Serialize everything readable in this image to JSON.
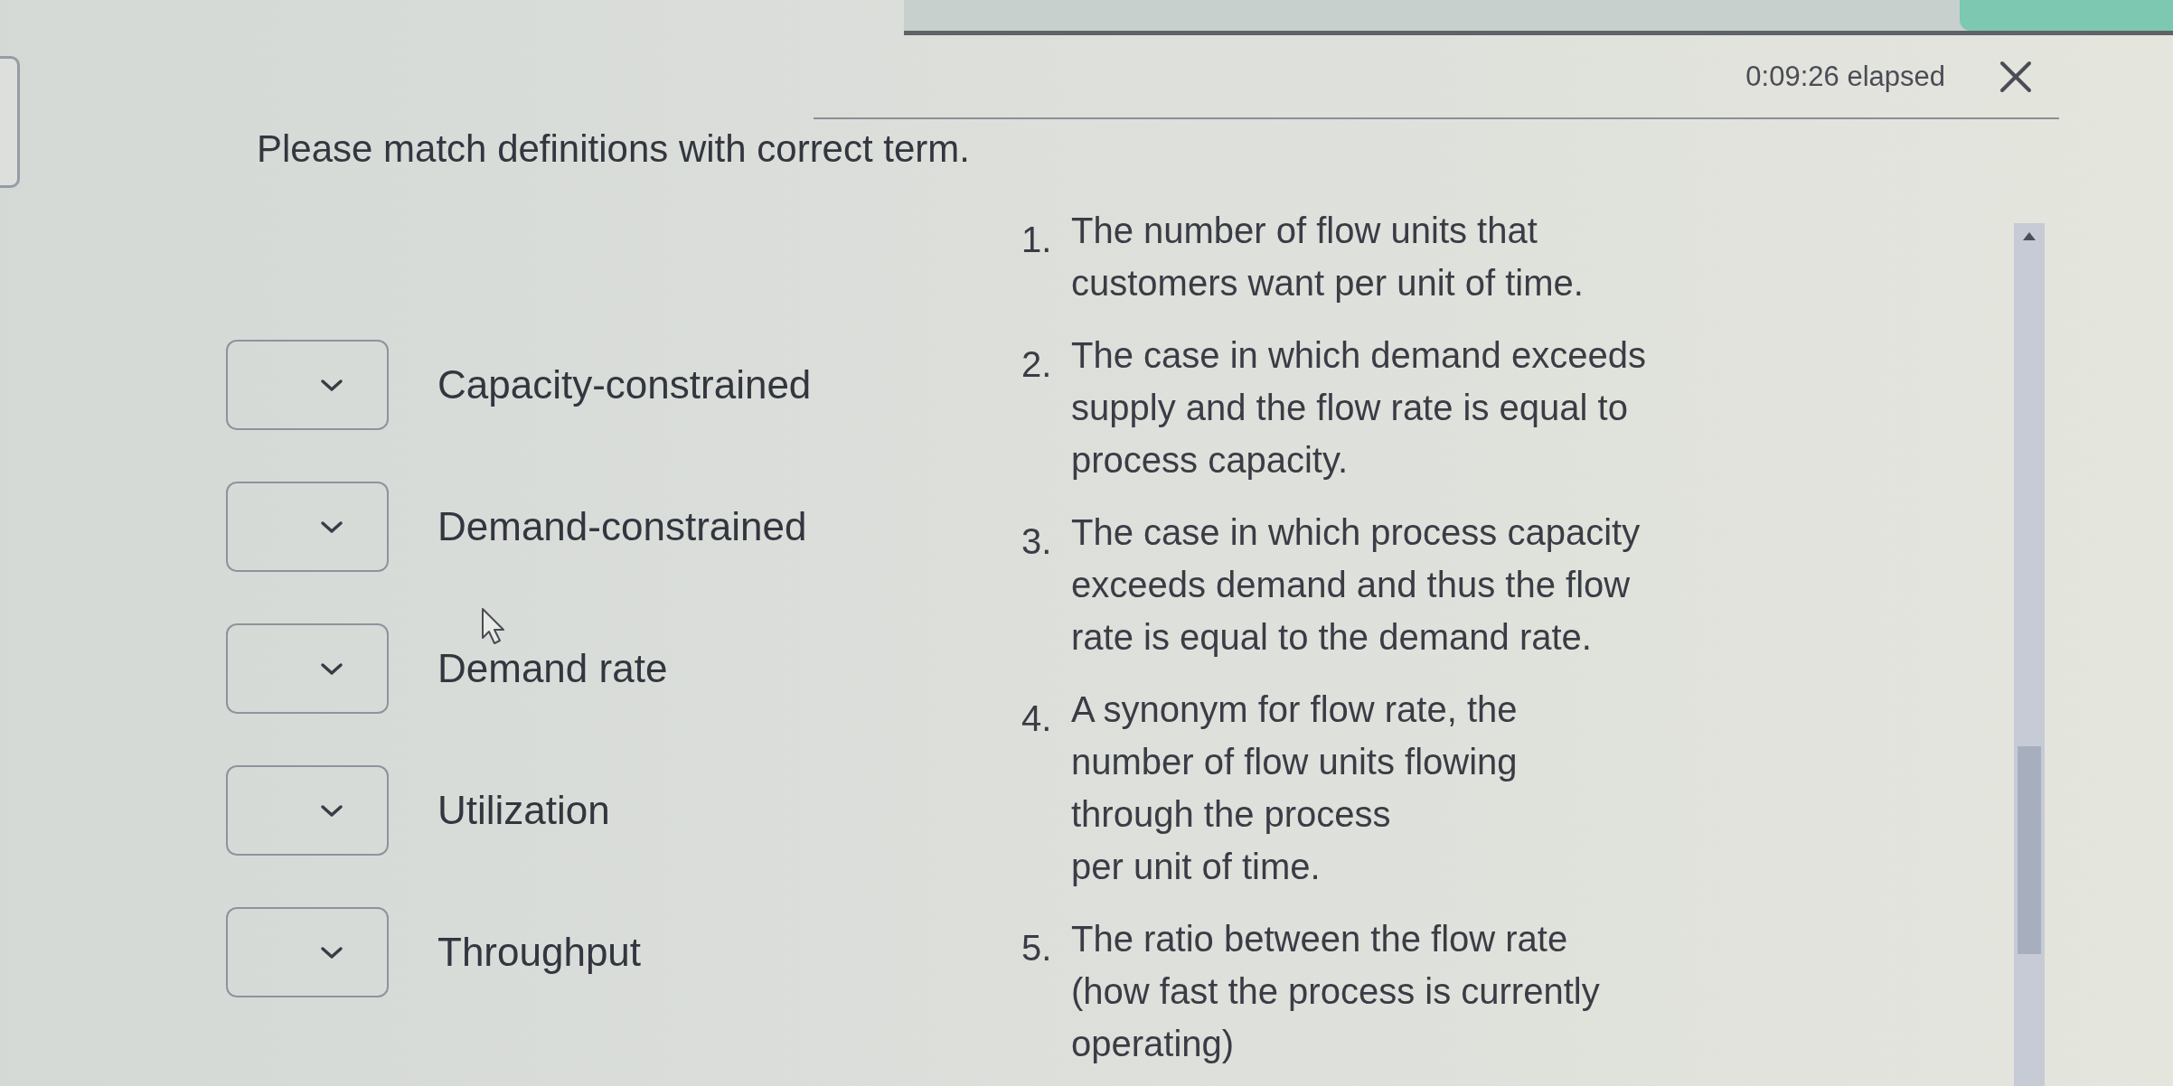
{
  "timer": {
    "elapsed": "0:09:26 elapsed"
  },
  "instructions": "Please match definitions with correct term.",
  "terms": [
    {
      "label": "Capacity-constrained"
    },
    {
      "label": "Demand-constrained"
    },
    {
      "label": "Demand rate"
    },
    {
      "label": "Utilization"
    },
    {
      "label": "Throughput"
    }
  ],
  "definitions": [
    {
      "number": "1.",
      "text": "The number of flow units that\ncustomers want per unit of time."
    },
    {
      "number": "2.",
      "text": "The case in which demand exceeds\nsupply and the flow rate is equal to\nprocess capacity."
    },
    {
      "number": "3.",
      "text": "The case in which process capacity\nexceeds demand and thus the flow\nrate is equal to the demand rate."
    },
    {
      "number": "4.",
      "text": "A synonym for flow rate, the\nnumber of flow units flowing\nthrough the process\nper unit of time."
    },
    {
      "number": "5.",
      "text": "The ratio between the flow rate\n(how fast the process is currently\noperating)"
    }
  ]
}
